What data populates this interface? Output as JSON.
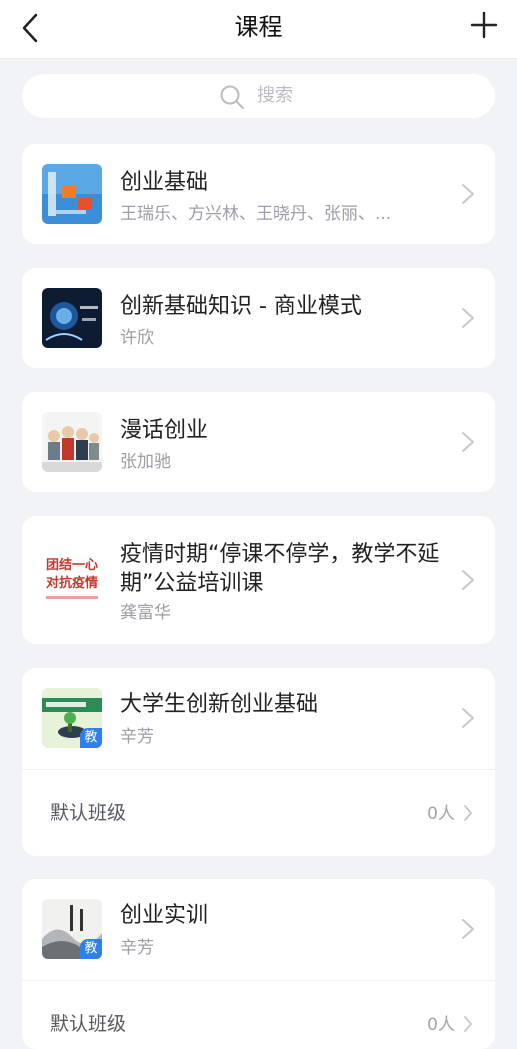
{
  "header": {
    "title": "课程"
  },
  "search": {
    "placeholder": "搜索"
  },
  "courses": [
    {
      "title": "创业基础",
      "teachers": "王瑞乐、方兴林、王晓丹、张丽、...",
      "thumb_icon": "entrepreneurship-basics-thumbnail"
    },
    {
      "title": "创新基础知识 - 商业模式",
      "teachers": "许欣",
      "thumb_icon": "business-model-thumbnail"
    },
    {
      "title": "漫话创业",
      "teachers": "张加驰",
      "thumb_icon": "cartoon-people-thumbnail"
    },
    {
      "title": "疫情时期“停课不停学，教学不延期”公益培训课",
      "teachers": "龚富华",
      "thumb_icon": "epidemic-poster-thumbnail",
      "thumb_text_1": "团结一心",
      "thumb_text_2": "对抗疫情"
    },
    {
      "title": "大学生创新创业基础",
      "teachers": "辛芳",
      "thumb_icon": "innovation-course-thumbnail",
      "badge": "教",
      "class_label": "默认班级",
      "class_count": "0人"
    },
    {
      "title": "创业实训",
      "teachers": "辛芳",
      "thumb_icon": "ink-landscape-thumbnail",
      "badge": "教",
      "class_label": "默认班级",
      "class_count": "0人"
    }
  ],
  "colors": {
    "accent": "#2f80ed",
    "background": "#f2f3f7"
  }
}
